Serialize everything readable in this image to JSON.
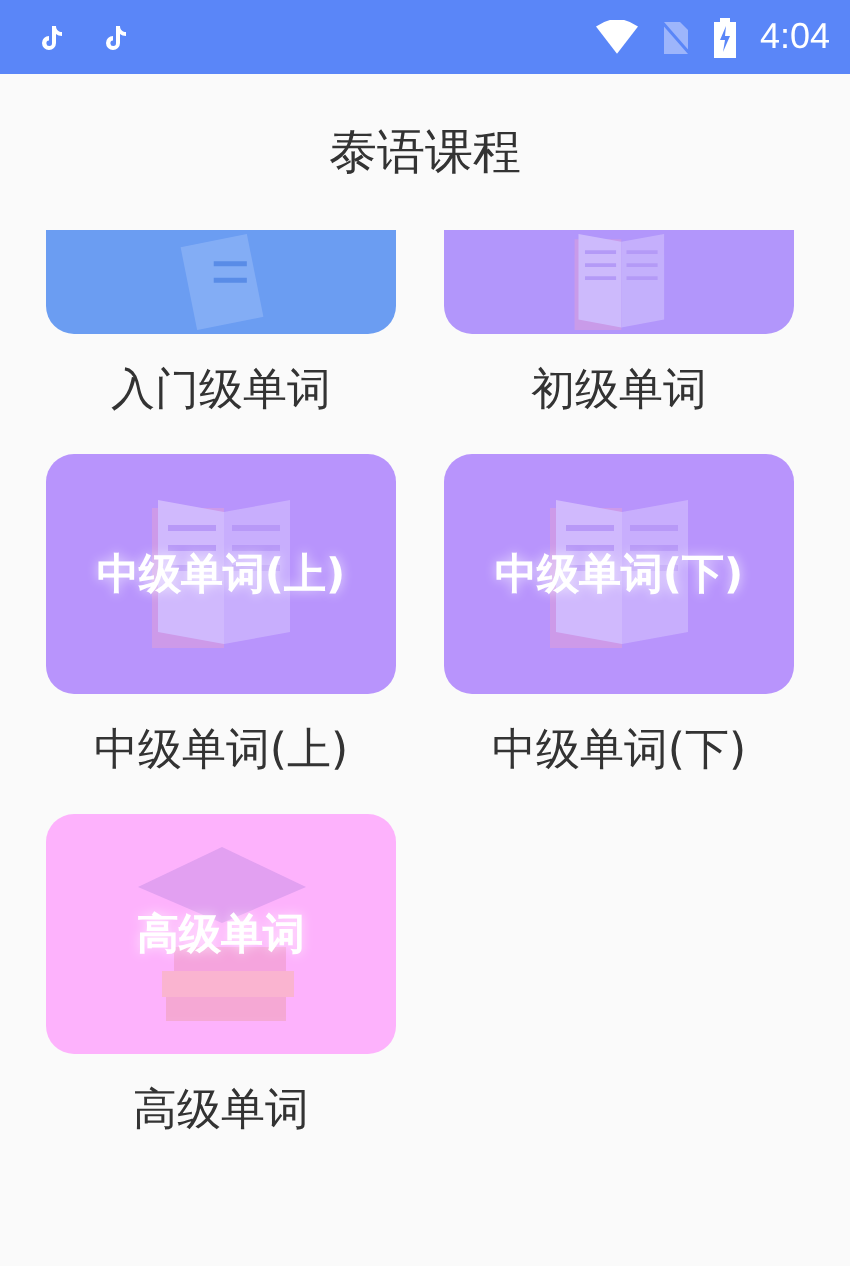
{
  "status_bar": {
    "time": "4:04"
  },
  "header": {
    "title": "泰语课程"
  },
  "courses": [
    {
      "label": "入门级单词",
      "color": "#6b9df2",
      "kind": "paper"
    },
    {
      "label": "初级单词",
      "color": "#b296fb",
      "kind": "book"
    },
    {
      "label": "中级单词(上)",
      "color": "#b894fc",
      "kind": "book",
      "banner": "中级单词(上)"
    },
    {
      "label": "中级单词(下)",
      "color": "#b894fc",
      "kind": "book",
      "banner": "中级单词(下)"
    },
    {
      "label": "高级单词",
      "color": "#fdb2fc",
      "kind": "cap",
      "banner": "高级单词"
    }
  ]
}
